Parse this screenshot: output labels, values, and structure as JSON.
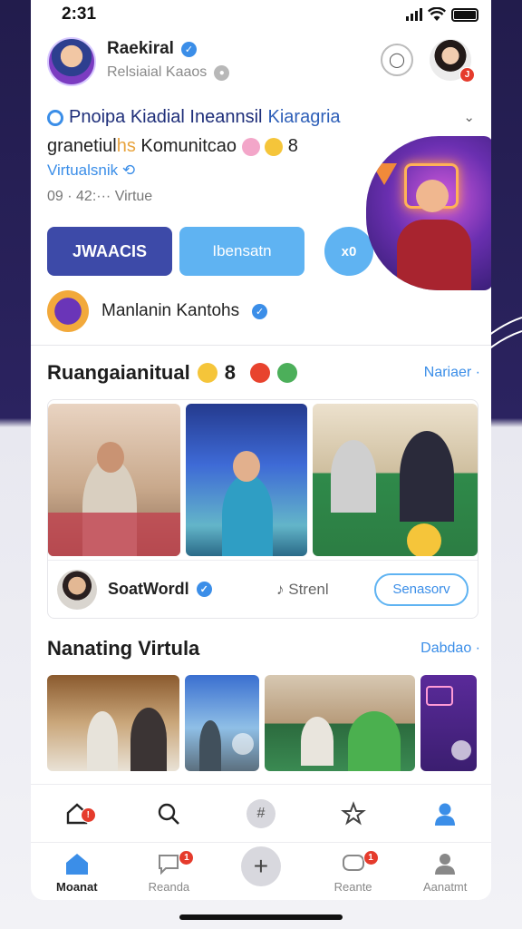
{
  "status_bar": {
    "time": "2:31"
  },
  "header": {
    "name": "Raekiral",
    "subtitle": "Relsiaial Kaaos"
  },
  "feature": {
    "title_prefix": "Pnoipa Kiadial Ineannsil",
    "title_accent": "Kiaragria",
    "line2_prefix": "granetiul",
    "line2_highlight": "hs",
    "line2_rest": "Komunitcao",
    "line2_count": "8",
    "line3": "Virtualsnik",
    "stats": "09 · 42:··· Virtue",
    "primary_button": "JWAACIS",
    "secondary_button": "Ibensatn",
    "bubble_label": "x0"
  },
  "creator": {
    "name": "Manlanin Kantohs"
  },
  "section1": {
    "title": "Ruangaianitual",
    "count": "8",
    "see_more": "Nariaer ·"
  },
  "card_footer": {
    "name": "SoatWordl",
    "stat": "Strenl",
    "follow_button": "Senasorv"
  },
  "section2": {
    "title": "Nanating Virtula",
    "see_more": "Dabdao ·"
  },
  "tabbar": {
    "tabs": [
      {
        "label": "Moanat",
        "active": true
      },
      {
        "label": "Reanda",
        "active": false,
        "badge": "1"
      },
      {
        "label": "",
        "active": false
      },
      {
        "label": "Reante",
        "active": false,
        "badge": "1"
      },
      {
        "label": "Aanatmt",
        "active": false
      }
    ]
  },
  "colors": {
    "accent": "#3b8ee8",
    "primary_button": "#3d4aa8",
    "secondary_button": "#5fb3f2",
    "badge": "#e53b2c"
  },
  "icons": [
    "wifi-icon",
    "battery-icon",
    "verified-icon",
    "chat-icon",
    "chevron-down-icon",
    "home-icon",
    "search-icon",
    "plus-icon",
    "star-icon",
    "profile-icon",
    "message-icon"
  ]
}
